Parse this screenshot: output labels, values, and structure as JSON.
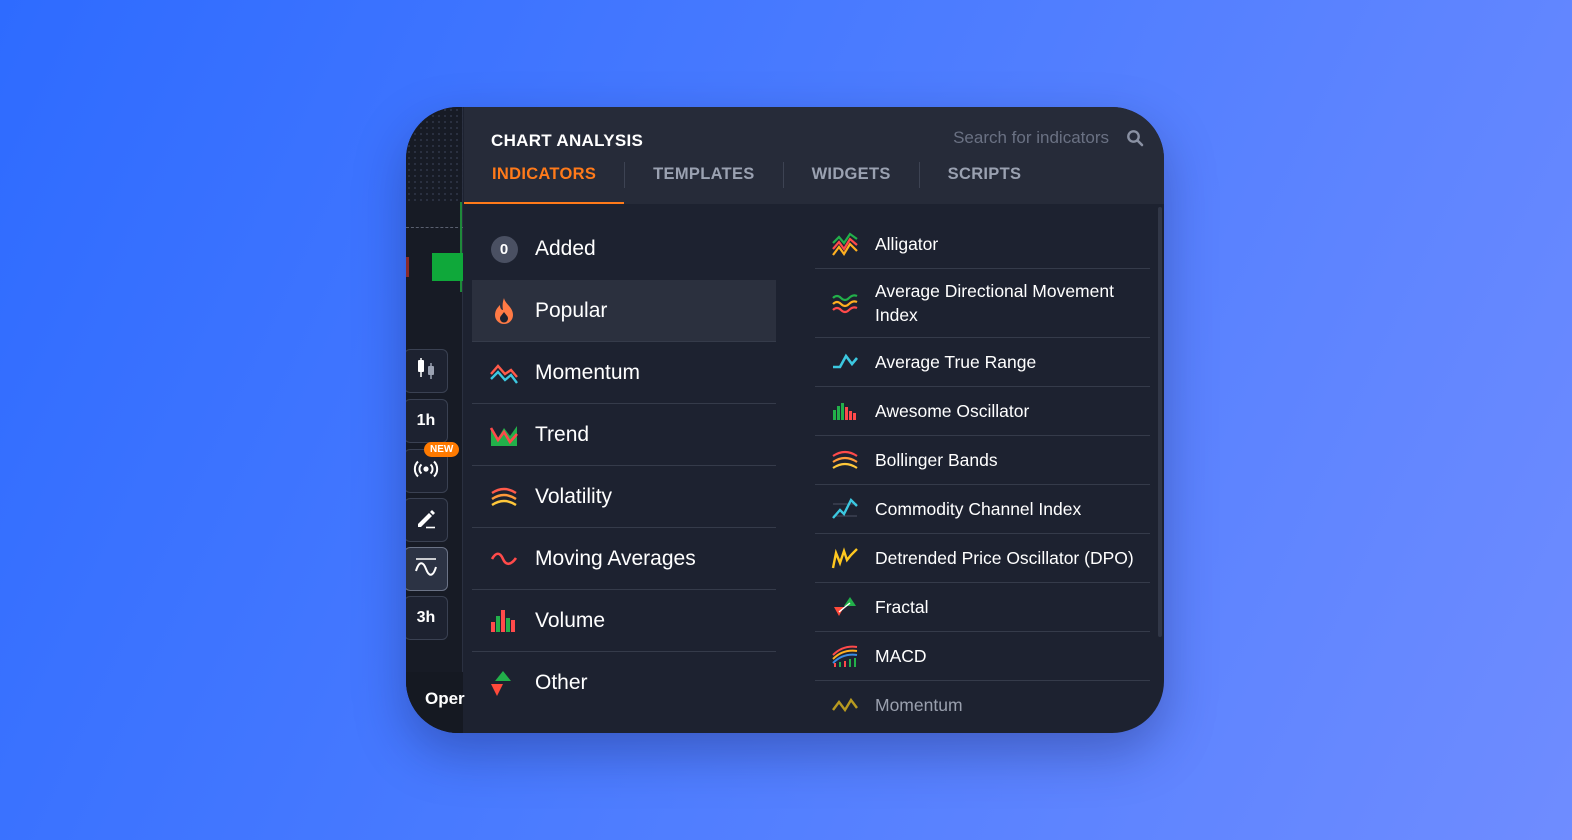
{
  "panel": {
    "title": "CHART ANALYSIS",
    "search_placeholder": "Search for indicators",
    "tabs": [
      {
        "label": "INDICATORS",
        "active": true
      },
      {
        "label": "TEMPLATES",
        "active": false
      },
      {
        "label": "WIDGETS",
        "active": false
      },
      {
        "label": "SCRIPTS",
        "active": false
      }
    ]
  },
  "toolbar": {
    "timeframe_1": "1h",
    "timeframe_2": "3h",
    "new_badge": "NEW",
    "footer_text": "Oper",
    "icons": [
      "candles-icon",
      "broadcast-icon",
      "pencil-icon",
      "indicator-wave-icon"
    ]
  },
  "categories": {
    "added": {
      "count": "0",
      "label": "Added"
    },
    "items": [
      {
        "label": "Popular",
        "icon": "fire-icon",
        "selected": true
      },
      {
        "label": "Momentum",
        "icon": "momentum-icon"
      },
      {
        "label": "Trend",
        "icon": "trend-icon"
      },
      {
        "label": "Volatility",
        "icon": "volatility-icon"
      },
      {
        "label": "Moving Averages",
        "icon": "moving-average-icon"
      },
      {
        "label": "Volume",
        "icon": "volume-icon"
      },
      {
        "label": "Other",
        "icon": "other-arrows-icon"
      }
    ]
  },
  "indicators": [
    {
      "label": "Alligator",
      "icon": "alligator-icon"
    },
    {
      "label": "Average Directional Movement Index",
      "icon": "adx-icon"
    },
    {
      "label": "Average True Range",
      "icon": "atr-icon"
    },
    {
      "label": "Awesome Oscillator",
      "icon": "awesome-oscillator-icon"
    },
    {
      "label": "Bollinger Bands",
      "icon": "bollinger-icon"
    },
    {
      "label": "Commodity Channel Index",
      "icon": "cci-icon"
    },
    {
      "label": "Detrended Price Oscillator (DPO)",
      "icon": "dpo-icon"
    },
    {
      "label": "Fractal",
      "icon": "fractal-icon"
    },
    {
      "label": "MACD",
      "icon": "macd-icon"
    },
    {
      "label": "Momentum",
      "icon": "momentum-indicator-icon"
    }
  ],
  "colors": {
    "accent": "#ff7a1a",
    "panel_bg": "#1d2230",
    "header_bg": "#262b39"
  }
}
